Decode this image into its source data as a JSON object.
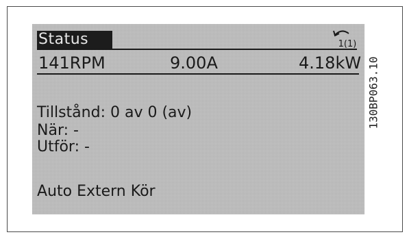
{
  "display": {
    "title": "Status",
    "menu_indicator": "1(1)",
    "readouts": {
      "speed": "141RPM",
      "current": "9.00A",
      "power": "4.18kW"
    },
    "lines": {
      "state": "Tillstånd: 0 av 0 (av)",
      "when": "När: -",
      "do": "Utför: -",
      "mode": "Auto Extern Kör"
    }
  },
  "figure_code": "130BP063.10"
}
